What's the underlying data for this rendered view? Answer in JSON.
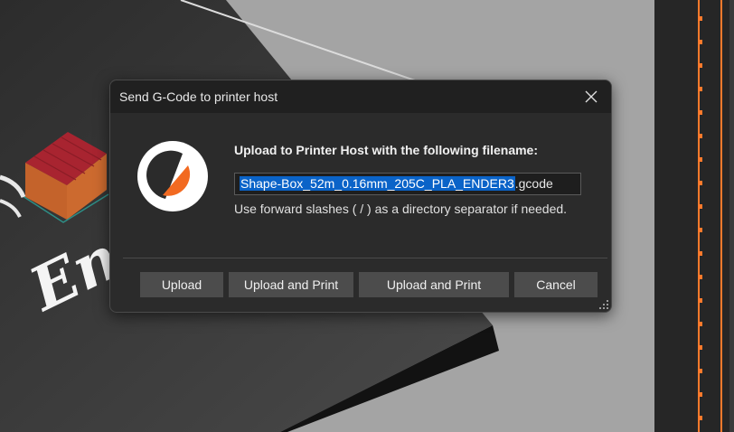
{
  "dialog": {
    "title": "Send G-Code to printer host",
    "heading": "Upload to Printer Host with the following filename:",
    "filename_selected": "Shape-Box_52m_0.16mm_205C_PLA_ENDER3",
    "filename_ext": ".gcode",
    "hint": "Use forward slashes ( / ) as a directory separator if needed.",
    "buttons": {
      "upload": "Upload",
      "upload_print_1": "Upload and Print",
      "upload_print_2": "Upload and Print",
      "cancel": "Cancel"
    }
  },
  "background": {
    "bed_label_partial": "En"
  },
  "colors": {
    "accent": "#ff7a2c",
    "selection": "#0a63c8",
    "logo_orange": "#f26a21"
  }
}
